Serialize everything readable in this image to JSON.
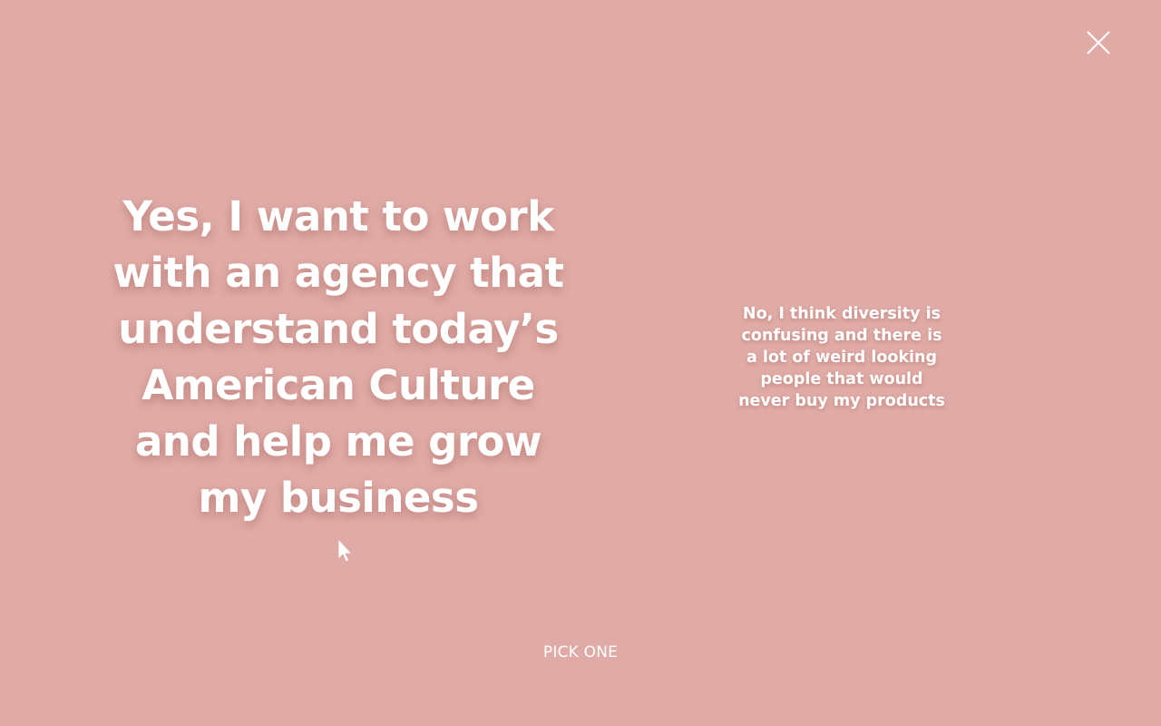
{
  "modal": {
    "close_icon": "close-icon",
    "option_yes_label": "Yes, I want to work with an agency that understand today’s American Culture and help me grow my business",
    "option_no_label": "No, I think diversity is confusing and there is a lot of weird looking people that would never buy my products",
    "footer_label": "PICK ONE"
  },
  "colors": {
    "background": "#e0aba6",
    "text": "#ffffff"
  },
  "cursor_icon": "mouse-pointer-icon"
}
